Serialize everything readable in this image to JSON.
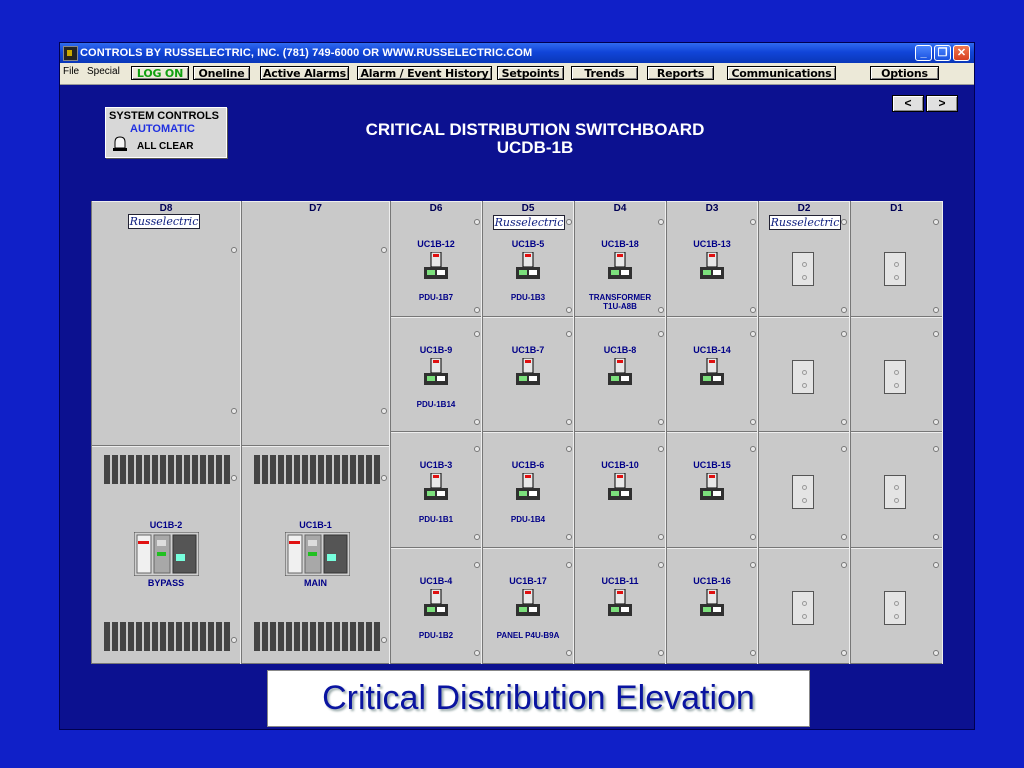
{
  "window": {
    "title": "CONTROLS BY RUSSELECTRIC, INC. (781) 749-6000 OR WWW.RUSSELECTRIC.COM",
    "controls": {
      "minimize": "_",
      "maximize": "❐",
      "close": "✕"
    }
  },
  "menu": {
    "file": "File",
    "special": "Special",
    "buttons": [
      "LOG ON",
      "Oneline",
      "Active Alarms",
      "Alarm / Event History",
      "Setpoints",
      "Trends",
      "Reports",
      "Communications",
      "Options"
    ]
  },
  "system_controls": {
    "title": "SYSTEM CONTROLS",
    "mode": "AUTOMATIC",
    "status": "ALL CLEAR"
  },
  "page": {
    "title_line1": "CRITICAL DISTRIBUTION SWITCHBOARD",
    "title_line2": "UCDB-1B",
    "nav_prev": "<",
    "nav_next": ">"
  },
  "brand_logo": "Russelectric",
  "sections": {
    "D8": {
      "label": "D8",
      "breaker": "UC1B-2",
      "name": "BYPASS"
    },
    "D7": {
      "label": "D7",
      "breaker": "UC1B-1",
      "name": "MAIN"
    },
    "D6": {
      "label": "D6",
      "units": [
        {
          "id": "UC1B-12",
          "load": "PDU-1B7"
        },
        {
          "id": "UC1B-9",
          "load": "PDU-1B14"
        },
        {
          "id": "UC1B-3",
          "load": "PDU-1B1"
        },
        {
          "id": "UC1B-4",
          "load": "PDU-1B2"
        }
      ]
    },
    "D5": {
      "label": "D5",
      "units": [
        {
          "id": "UC1B-5",
          "load": "PDU-1B3"
        },
        {
          "id": "UC1B-7",
          "load": ""
        },
        {
          "id": "UC1B-6",
          "load": "PDU-1B4"
        },
        {
          "id": "UC1B-17",
          "load": "PANEL P4U-B9A"
        }
      ]
    },
    "D4": {
      "label": "D4",
      "units": [
        {
          "id": "UC1B-18",
          "load": "TRANSFORMER",
          "load2": "T1U-A8B"
        },
        {
          "id": "UC1B-8",
          "load": ""
        },
        {
          "id": "UC1B-10",
          "load": ""
        },
        {
          "id": "UC1B-11",
          "load": ""
        }
      ]
    },
    "D3": {
      "label": "D3",
      "units": [
        {
          "id": "UC1B-13",
          "load": ""
        },
        {
          "id": "UC1B-14",
          "load": ""
        },
        {
          "id": "UC1B-15",
          "load": ""
        },
        {
          "id": "UC1B-16",
          "load": ""
        }
      ]
    },
    "D2": {
      "label": "D2"
    },
    "D1": {
      "label": "D1"
    }
  },
  "caption": "Critical Distribution Elevation"
}
